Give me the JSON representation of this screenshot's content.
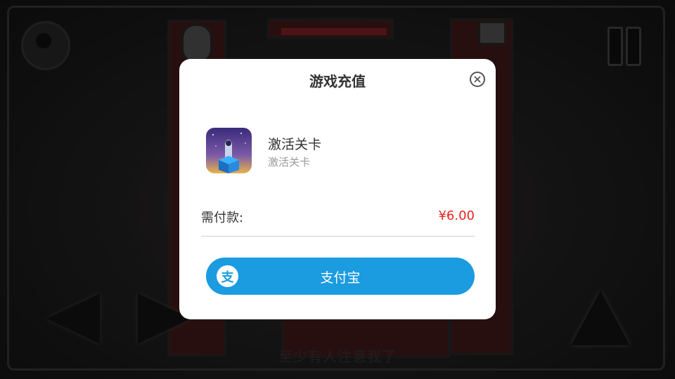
{
  "game": {
    "subtitle": "至少有人注意我了"
  },
  "dialog": {
    "title": "游戏充值",
    "product": {
      "name": "激活关卡",
      "description": "激活关卡"
    },
    "payment": {
      "label": "需付款:",
      "amount": "¥6.00"
    },
    "alipay_button": {
      "logo_text": "支",
      "label": "支付宝"
    }
  },
  "colors": {
    "accent": "#1b9be0",
    "price": "#e8231f"
  },
  "icons": [
    "key-icon",
    "pause-icon",
    "close-icon",
    "alipay-icon",
    "left-arrow-icon",
    "right-arrow-icon",
    "jump-arrow-icon"
  ]
}
